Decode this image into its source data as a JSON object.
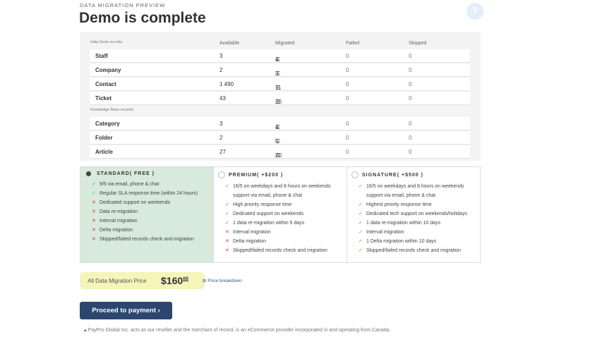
{
  "header": {
    "kicker": "DATA MIGRATION PREVIEW",
    "title": "Demo is complete",
    "help": "?"
  },
  "table": {
    "columns": [
      "Available",
      "Migrated",
      "Failed",
      "Skipped"
    ],
    "sections": [
      {
        "label": "Help Desk records",
        "rows": [
          {
            "name": "Staff",
            "available": "3",
            "migrated": "4",
            "failed": "0",
            "skipped": "0"
          },
          {
            "name": "Company",
            "available": "2",
            "migrated": "3",
            "failed": "0",
            "skipped": "0"
          },
          {
            "name": "Contact",
            "available": "1 490",
            "migrated": "11",
            "failed": "0",
            "skipped": "0"
          },
          {
            "name": "Ticket",
            "available": "43",
            "migrated": "20",
            "failed": "0",
            "skipped": "0"
          }
        ]
      },
      {
        "label": "Knowledge Base records",
        "rows": [
          {
            "name": "Category",
            "available": "3",
            "migrated": "4",
            "failed": "0",
            "skipped": "0"
          },
          {
            "name": "Folder",
            "available": "2",
            "migrated": "5",
            "failed": "0",
            "skipped": "0"
          },
          {
            "name": "Article",
            "available": "27",
            "migrated": "20",
            "failed": "0",
            "skipped": "0"
          }
        ]
      }
    ]
  },
  "plans": [
    {
      "name": "STANDARD( FREE )",
      "selected": true,
      "features": [
        {
          "ok": true,
          "text": "9/5 via email, phone & chat"
        },
        {
          "ok": true,
          "text": "Regular SLA response time (within 24 hours)"
        },
        {
          "ok": false,
          "text": "Dedicated support on weekends"
        },
        {
          "ok": false,
          "text": "Data re-migration"
        },
        {
          "ok": false,
          "text": "Interval migration"
        },
        {
          "ok": false,
          "text": "Delta migration"
        },
        {
          "ok": false,
          "text": "Skipped/failed records check and migration"
        }
      ]
    },
    {
      "name": "PREMIUM( +$200 )",
      "selected": false,
      "features": [
        {
          "ok": true,
          "text": "16/5 on weekdays and 8 hours on weekends support via email, phone & chat"
        },
        {
          "ok": true,
          "text": "High priority response time"
        },
        {
          "ok": true,
          "text": "Dedicated support on weekends"
        },
        {
          "ok": true,
          "text": "1 data re-migration within 5 days"
        },
        {
          "ok": false,
          "text": "Interval migration"
        },
        {
          "ok": false,
          "text": "Delta migration"
        },
        {
          "ok": false,
          "text": "Skipped/failed records check and migration"
        }
      ]
    },
    {
      "name": "SIGNATURE( +$500 )",
      "selected": false,
      "features": [
        {
          "ok": true,
          "text": "16/5 on weekdays and 8 hours on weekends support via email, phone & chat"
        },
        {
          "ok": true,
          "text": "Highest priority response time"
        },
        {
          "ok": true,
          "text": "Dedicated tech support on weekends/holidays"
        },
        {
          "ok": true,
          "text": "1 data re-migration within 10 days"
        },
        {
          "ok": true,
          "text": "Interval migration"
        },
        {
          "ok": true,
          "text": "1 Delta migration within 10 days"
        },
        {
          "ok": true,
          "text": "Skipped/failed records check and migration"
        }
      ]
    }
  ],
  "price": {
    "label": "All Data Migration Price",
    "amount": "$160",
    "cents": "00",
    "breakdown": "Price breakdown"
  },
  "cta": {
    "label": "Proceed to payment"
  },
  "footer": "PayPro Global Inc. acts as our reseller and the merchant of record, is an eCommerce provider incorporated in and operating from Canada."
}
